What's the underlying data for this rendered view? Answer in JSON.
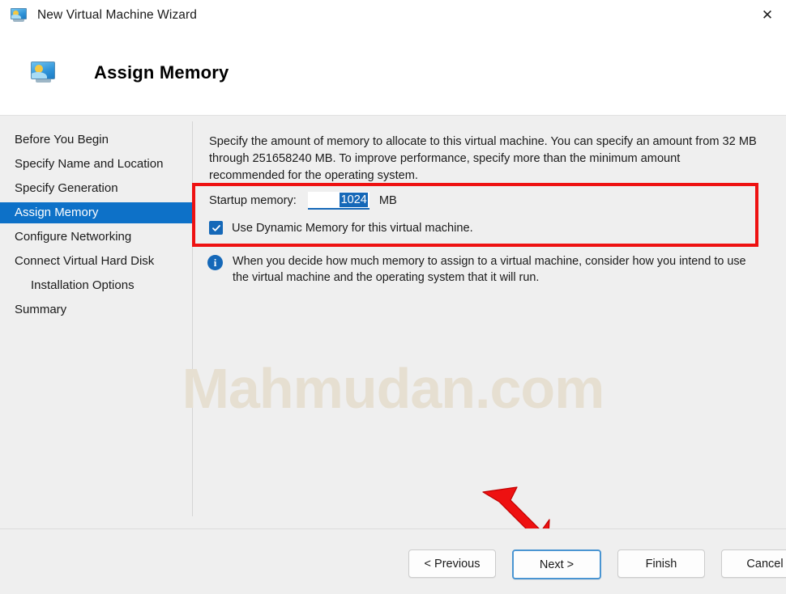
{
  "window": {
    "title": "New Virtual Machine Wizard",
    "icon": "virtual-machine-icon",
    "close_label": "✕"
  },
  "banner": {
    "title": "Assign Memory",
    "icon": "virtual-machine-icon"
  },
  "sidebar": {
    "items": [
      {
        "label": "Before You Begin",
        "active": false,
        "indent": false
      },
      {
        "label": "Specify Name and Location",
        "active": false,
        "indent": false
      },
      {
        "label": "Specify Generation",
        "active": false,
        "indent": false
      },
      {
        "label": "Assign Memory",
        "active": true,
        "indent": false
      },
      {
        "label": "Configure Networking",
        "active": false,
        "indent": false
      },
      {
        "label": "Connect Virtual Hard Disk",
        "active": false,
        "indent": false
      },
      {
        "label": "Installation Options",
        "active": false,
        "indent": true
      },
      {
        "label": "Summary",
        "active": false,
        "indent": false
      }
    ]
  },
  "main": {
    "description": "Specify the amount of memory to allocate to this virtual machine. You can specify an amount from 32 MB through 251658240 MB. To improve performance, specify more than the minimum amount recommended for the operating system.",
    "startup_memory": {
      "label": "Startup memory:",
      "value": "1024",
      "unit": "MB",
      "selected": true
    },
    "dynamic_memory": {
      "label": "Use Dynamic Memory for this virtual machine.",
      "checked": true
    },
    "note": {
      "icon": "info-icon",
      "text": "When you decide how much memory to assign to a virtual machine, consider how you intend to use the virtual machine and the operating system that it will run."
    }
  },
  "footer": {
    "buttons": [
      {
        "label": "< Previous",
        "focused": false
      },
      {
        "label": "Next >",
        "focused": true
      },
      {
        "label": "Finish",
        "focused": false
      },
      {
        "label": "Cancel",
        "focused": false
      }
    ]
  },
  "annotations": {
    "highlight_box_color": "#ee1111",
    "arrow_color": "#ee1111",
    "arrow_name": "red-pointer-arrow"
  },
  "watermark": {
    "text": "Mahmudan.com",
    "color": "#e6dfd1"
  }
}
